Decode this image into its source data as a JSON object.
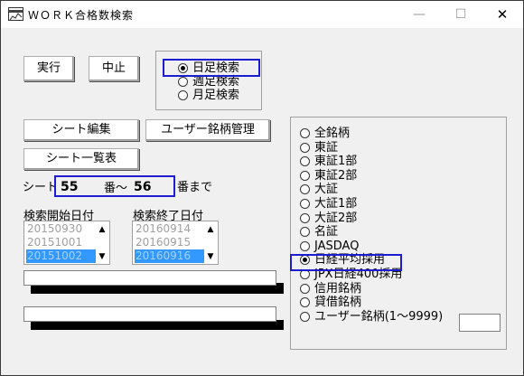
{
  "window": {
    "title": "ＷＯＲＫ合格数検索"
  },
  "titlebar": {
    "minimize": "—",
    "maximize": "☐",
    "close": "✕"
  },
  "buttons": {
    "run": "実行",
    "stop": "中止",
    "sheet_edit": "シート編集",
    "user_stock_mgmt": "ユーザー銘柄管理",
    "sheet_list": "シート一覧表"
  },
  "period": {
    "options": [
      "日足検索",
      "週足検索",
      "月足検索"
    ],
    "selected_index": 0
  },
  "sheet_range": {
    "label": "シート",
    "from_value": "55",
    "middle": "番～",
    "to_value": "56",
    "suffix": "番まで"
  },
  "start_date": {
    "label": "検索開始日付",
    "items": [
      "20150930",
      "20151001",
      "20151002"
    ],
    "selected_index": 2
  },
  "end_date": {
    "label": "検索終了日付",
    "items": [
      "20160914",
      "20160915",
      "20160916"
    ],
    "selected_index": 2
  },
  "progress": {
    "bar1": 0,
    "bar2": 0
  },
  "market": {
    "options": [
      "全銘柄",
      "東証",
      "東証1部",
      "東証2部",
      "大証",
      "大証1部",
      "大証2部",
      "名証",
      "JASDAQ",
      "日経平均採用",
      "JPX日経400採用",
      "信用銘柄",
      "貸借銘柄",
      "ユーザー銘柄(1～9999)"
    ],
    "selected_index": 9,
    "user_code_value": ""
  },
  "icons": {
    "app": "app-window-icon",
    "scroll_up": "scroll-up-arrow-icon",
    "scroll_down": "scroll-down-arrow-icon"
  },
  "colors": {
    "focus_border": "#1c1cd0",
    "selection": "#3399ff"
  }
}
